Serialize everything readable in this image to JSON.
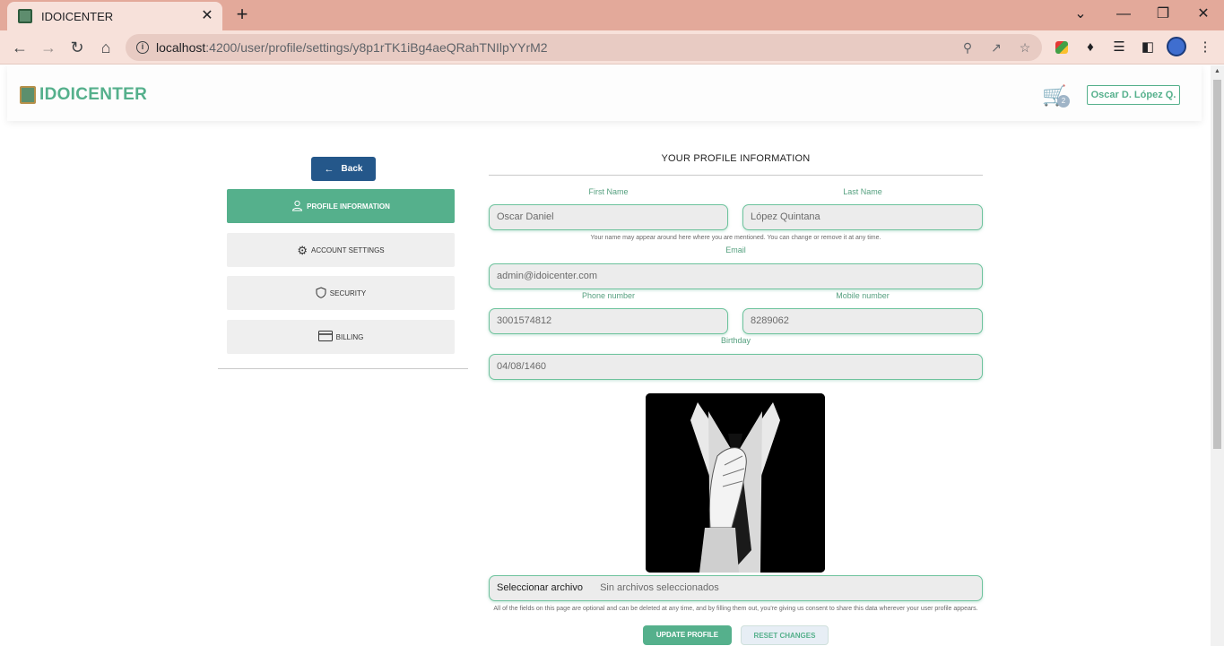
{
  "browser": {
    "tab_title": "IDOICENTER",
    "tab_close": "✕",
    "new_tab": "+",
    "url_host": "localhost",
    "url_path": ":4200/user/profile/settings/y8p1rTK1iBg4aeQRahTNIlpYYrM2",
    "window_controls": [
      "⌄",
      "—",
      "❐",
      "✕"
    ]
  },
  "navbar": {
    "brand": "IDOICENTER",
    "cart_count": "2",
    "user_name": "Oscar D. López Q."
  },
  "sidebar": {
    "back_label": "Back",
    "items": [
      {
        "label": "PROFILE INFORMATION",
        "icon": "user-icon",
        "active": true
      },
      {
        "label": "ACCOUNT SETTINGS",
        "icon": "gear-icon",
        "active": false
      },
      {
        "label": "SECURITY",
        "icon": "shield-icon",
        "active": false
      },
      {
        "label": "BILLING",
        "icon": "credit-card-icon",
        "active": false
      }
    ]
  },
  "form": {
    "title": "YOUR PROFILE INFORMATION",
    "first_name_label": "First Name",
    "first_name": "Oscar Daniel",
    "last_name_label": "Last Name",
    "last_name": "López Quintana",
    "name_help": "Your name may appear around here where you are mentioned. You can change or remove it at any time.",
    "email_label": "Email",
    "email": "admin@idoicenter.com",
    "phone_label": "Phone number",
    "phone": "3001574812",
    "mobile_label": "Mobile number",
    "mobile": "8289062",
    "birthday_label": "Birthday",
    "birthday": "04/08/1460",
    "file_button": "Seleccionar archivo",
    "file_status": "Sin archivos seleccionados",
    "consent_text": "All of the fields on this page are optional and can be deleted at any time, and by filling them out, you're giving us consent to share this data wherever your user profile appears.",
    "update_label": "UPDATE PROFILE",
    "reset_label": "RESET CHANGES"
  },
  "colors": {
    "accent": "#55b08c",
    "back_button": "#24578a",
    "tab_bar": "#e3a99a"
  }
}
